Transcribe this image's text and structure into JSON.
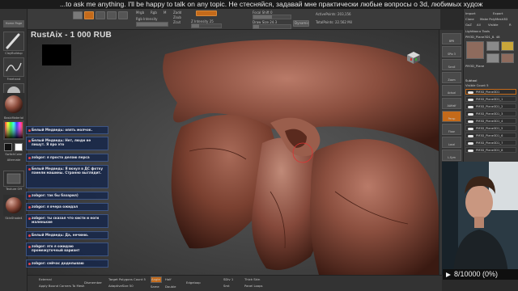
{
  "ticker": {
    "text": "...to ask me anything. I'll be happy to talk on any topic. Не стесняйся, задавай мне практически любые вопросы о 3d, любимых худож"
  },
  "topbar": {
    "brush_label": "Mrgb",
    "rgb_label": "Rgb",
    "m_label": "M",
    "zadd_label": "Zadd",
    "zsub_label": "Zsub",
    "zcut_label": "Zcut",
    "z_intensity_label": "Z Intensity 25",
    "rgb_intensity_label": "Rgb Intensity",
    "focal_shift_label": "Focal Shift 0",
    "draw_size_label": "Draw Size 24.3",
    "dynamic_label": "Dynamic",
    "active_points_label": "ActivePoints: 203,156",
    "total_points_label": "TotalPoints: 22.562 Mil"
  },
  "document": {
    "title": "RustAix - 1 000 RUB"
  },
  "left_shelf": {
    "home_page": "Home Page",
    "clay_buildup": "ClayBuildup",
    "freehand": "Freehand",
    "matcap": "BasicMaterial",
    "gradient": "Gradient",
    "switch_color": "SwitchColor",
    "alternate": "Alternate",
    "texture_off": "Texture Off",
    "material": "SkinShade4"
  },
  "right_column": {
    "buttons": [
      "BPR",
      "SPix 3",
      "Scroll",
      "Zoom",
      "Actual",
      "AAHalf",
      "Persp",
      "Floor",
      "Local",
      "L.Sym",
      "Frame",
      "Move",
      "Scale",
      "Rotate",
      "PolyF",
      "Transp",
      "Dynamic",
      "Solo"
    ]
  },
  "palette": {
    "import_label": "Import",
    "export_label": "Export",
    "clone_label": "Clone",
    "make_polymesh_label": "Make PolyMesh3D",
    "goz_label": "GoZ",
    "all_label": "All",
    "visible_label": "Visible",
    "r_label": "R",
    "lightbox_label": "Lightbox ▸ Tools",
    "tool_name": "PM3D_Plane3D1_8. 48",
    "thumb_labels": [
      "PM3D_Plane",
      "Cylinder3D",
      "PolyMesh3D",
      "SimpleBrush",
      "PM3D_Plane"
    ],
    "subtool_header": "Subtool",
    "visible_count": "Visible Count 5",
    "subtools": [
      "PM3D_Plane3D1",
      "PM3D_Plane3D1_1",
      "PM3D_Plane3D1_2",
      "PM3D_Plane3D1_3",
      "PM3D_Plane3D1_4",
      "PM3D_Plane3D1_5",
      "PM3D_Plane3D1_6",
      "PM3D_Plane3D1_7",
      "PM3D_Plane3D1_8"
    ]
  },
  "chat": {
    "messages": [
      "Белый Медведь: опять молчок.",
      "Белый Медведь: Нет, люди не пишут. Я про это",
      "zobgor: я просто делаю перса",
      "Белый Медведь: Я вкнул в ДС фотку панели машины. Странно выглядит.",
      "zobgor: так бы базарил)",
      "zobgor: я вчера ожидал",
      "zobgor: ты сказал что кисти и ноги маленькие",
      "Белый Медведь: Да, нечиню.",
      "zobgor: это я ожидаю промежуточный вариант",
      "zobgor: сейчас доделываю"
    ]
  },
  "counter": {
    "text": "8/10000  (0%)"
  },
  "bottombar": {
    "external_label": "External",
    "apply_bound_label": "Apply Bound Corners To Mesh",
    "dismember_label": "Dismember",
    "target_polygons_label": "Target Polygons Count 5",
    "adaptive_size_label": "AdaptiveSize 50",
    "angle_label": "Angle",
    "half_label": "Half",
    "same_label": "Same",
    "double_label": "Double",
    "edgeloop_label": "Edgeloop",
    "subdiv_label": "SDiv 1",
    "smt_label": "Smt",
    "thick_label": "Thick Skin",
    "panel_loops_label": "Panel Loops"
  },
  "icons": {
    "play": "play-icon",
    "eye": "eye-icon",
    "navcube": "nav-cube-icon"
  },
  "colors": {
    "accent_orange": "#c46a1a",
    "chat_bg": "#18284a",
    "clay": "#7a4536"
  }
}
